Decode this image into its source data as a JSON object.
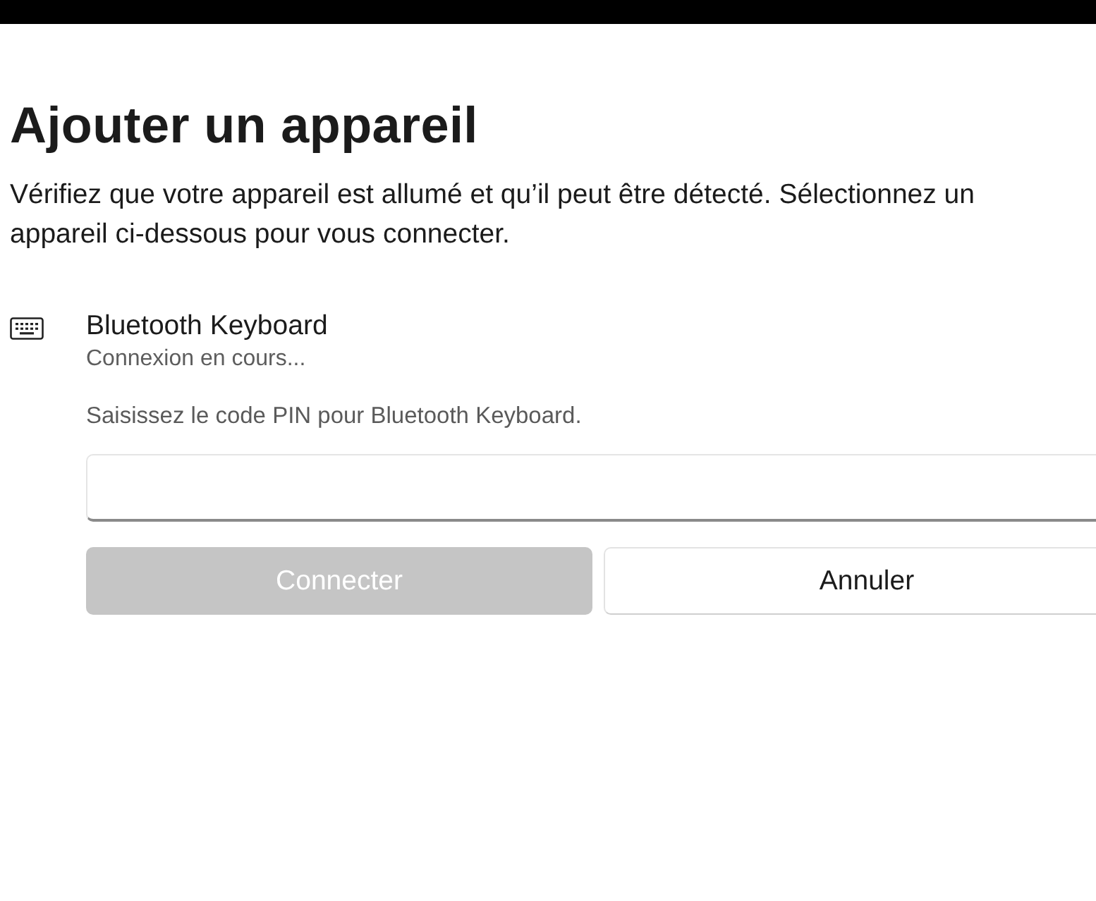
{
  "title": "Ajouter un appareil",
  "description": "Vérifiez que votre appareil est allumé et qu’il peut être détecté. Sélectionnez un appareil ci-dessous pour vous connecter.",
  "device": {
    "name": "Bluetooth Keyboard",
    "status": "Connexion en cours..."
  },
  "pin_prompt": "Saisissez le code PIN pour Bluetooth Keyboard.",
  "buttons": [
    {
      "label": "Connecter",
      "kind": "primary",
      "disabled": true
    },
    {
      "label": "Annuler",
      "kind": "secondary",
      "disabled": false
    }
  ]
}
